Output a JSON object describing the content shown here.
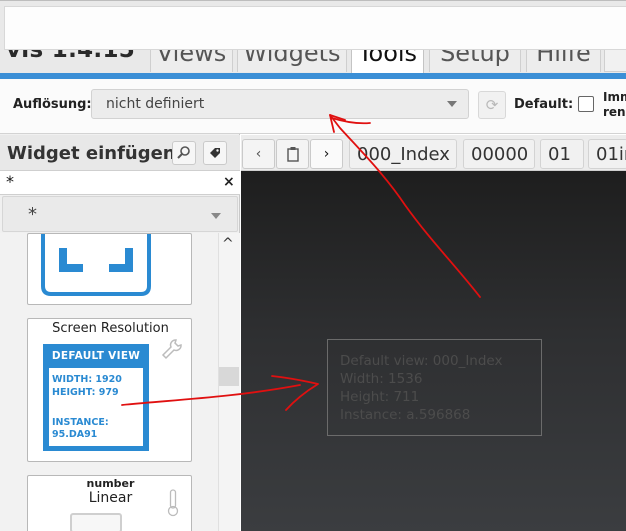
{
  "app": {
    "title": "vis 1.4.15"
  },
  "menu": {
    "tabs": [
      {
        "label": "Views"
      },
      {
        "label": "Widgets"
      },
      {
        "label": "Tools"
      },
      {
        "label": "Setup"
      },
      {
        "label": "Hilfe"
      }
    ],
    "active_tab": "Tools"
  },
  "tools": {
    "resolution_label": "Auflösung:",
    "resolution_value": "nicht definiert",
    "default_label": "Default:",
    "default_checked": false,
    "imm_label_line1": "Imm",
    "imm_label_line2": "ren"
  },
  "widget_panel": {
    "title": "Widget einfügen",
    "filter_value": "*",
    "filter_clear": "×",
    "set_value": "*",
    "scroll_up": "^",
    "widgets": [
      {
        "title": ""
      },
      {
        "title": "Screen Resolution",
        "preview": {
          "heading": "DEFAULT VIEW",
          "width_line": "WIDTH: 1920",
          "height_line": "HEIGHT: 979",
          "instance_label": "INSTANCE:",
          "instance_value": "95.DA91"
        }
      },
      {
        "title_top": "number",
        "title": "Linear"
      }
    ]
  },
  "views": {
    "nav_prev": "‹",
    "nav_clip": "▯",
    "nav_next": "›",
    "tabs": [
      {
        "label": "000_Index"
      },
      {
        "label": "00000"
      },
      {
        "label": "01"
      },
      {
        "label": "01in"
      }
    ]
  },
  "canvas": {
    "resolution_widget": {
      "line1": "Default view: 000_Index",
      "line2": "Width: 1536",
      "line3": "Height: 711",
      "line4": "Instance: a.596868"
    }
  },
  "colors": {
    "accent_blue": "#3b8fd6",
    "annotation_red": "#e01010",
    "canvas_dark": "#2e2f31"
  },
  "icons": {
    "refresh": "refresh-icon",
    "search": "search-icon",
    "tag": "tag-icon",
    "wrench": "wrench-icon",
    "thermometer": "thermometer-icon"
  }
}
